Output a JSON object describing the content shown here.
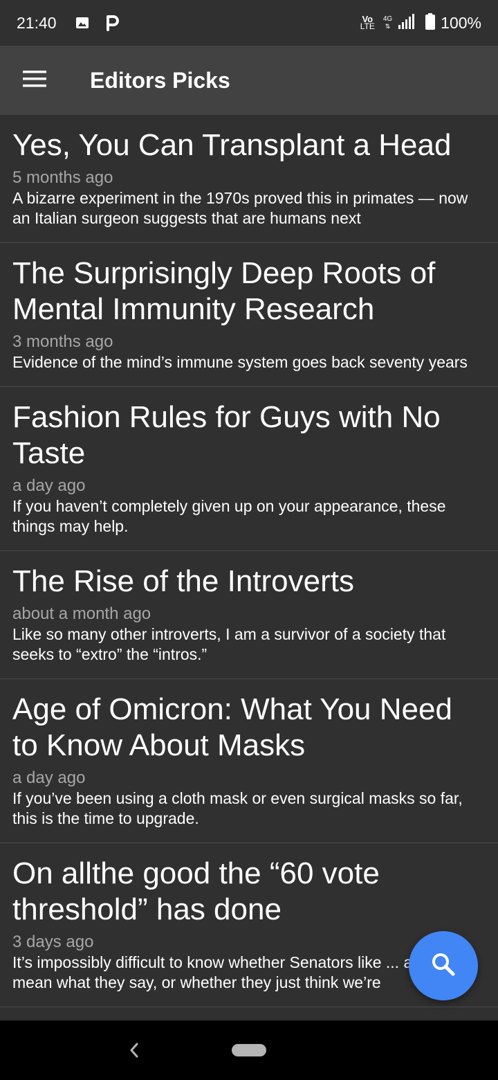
{
  "status_bar": {
    "time": "21:40",
    "icons": [
      "image-icon",
      "parking-icon"
    ],
    "volte_top": "Vo",
    "volte_bottom": "LTE",
    "network": "4G",
    "battery": "100%"
  },
  "app_bar": {
    "title": "Editors Picks",
    "menu_icon": "hamburger-menu-icon"
  },
  "articles": [
    {
      "title": "Yes, You Can Transplant a Head",
      "time": "5 months ago",
      "description": "A bizarre experiment in the 1970s proved this in primates — now an Italian surgeon suggests that are humans next"
    },
    {
      "title": "The Surprisingly Deep Roots of Mental Immunity Research",
      "time": "3 months ago",
      "description": "Evidence of the mind’s immune system goes back seventy years"
    },
    {
      "title": "Fashion Rules for Guys with No Taste",
      "time": "a day ago",
      "description": "If you haven’t completely given up on your appearance, these things may help."
    },
    {
      "title": "The Rise of the Introverts",
      "time": "about a month ago",
      "description": "Like so many other introverts, I am a survivor of a society that seeks to “extro” the “intros.”"
    },
    {
      "title": "Age of Omicron: What You Need to Know About Masks",
      "time": "a day ago",
      "description": "If you’ve been using a cloth mask or even surgical masks so far, this is the time to upgrade."
    },
    {
      "title": "On allthe good the “60 vote threshold” has done",
      "time": "3 days ago",
      "description": "It’s impossibly difficult to know whether Senators like ... actually mean what they say, or whether they just think we’re"
    }
  ],
  "fab": {
    "icon": "search-icon",
    "color": "#4285f4"
  },
  "colors": {
    "background": "#303030",
    "app_bar": "#424242",
    "secondary_text": "#a6a6a6"
  }
}
